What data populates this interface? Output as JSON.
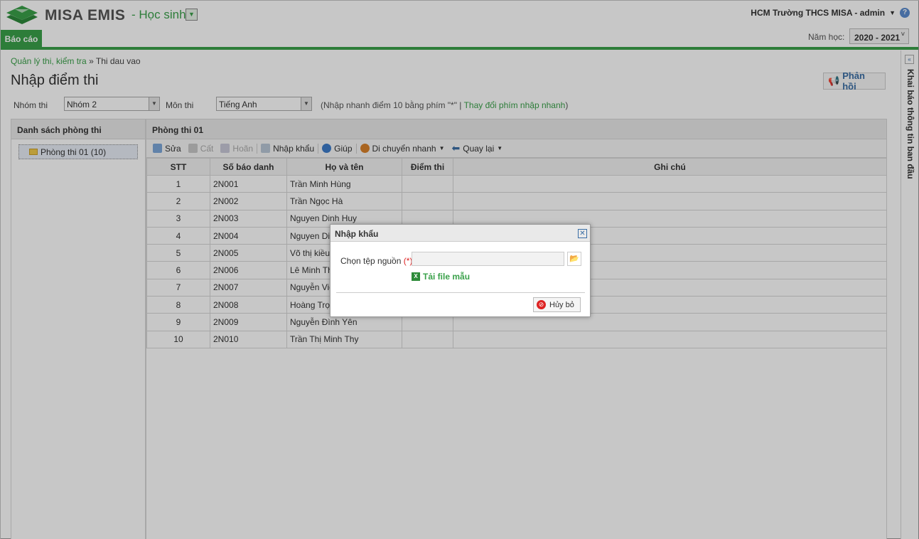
{
  "header": {
    "brand": "MISA EMIS",
    "module": "- Học sinh",
    "school_user": "HCM Trường THCS MISA - admin",
    "tab_report": "Báo cáo",
    "year_label": "Năm học:",
    "year_value": "2020 - 2021"
  },
  "breadcrumb": {
    "parent": "Quản lý thi, kiểm tra",
    "sep": "»",
    "current": "Thi dau vao"
  },
  "page_title": "Nhập điểm thi",
  "feedback_label": "Phản hồi",
  "filters": {
    "group_label": "Nhóm thi",
    "group_value": "Nhóm 2",
    "subject_label": "Môn thi",
    "subject_value": "Tiếng Anh",
    "hint_prefix": "(Nhập nhanh điểm 10 bằng phím \"*\" |",
    "hint_link": "Thay đổi phím nhập nhanh",
    "hint_suffix": ")"
  },
  "left_panel": {
    "title": "Danh sách phòng thi",
    "room": "Phòng thi 01 (10)"
  },
  "main_panel": {
    "title": "Phòng thi 01",
    "toolbar": {
      "edit": "Sửa",
      "save": "Cất",
      "undo": "Hoãn",
      "import": "Nhập khẩu",
      "help": "Giúp",
      "move": "Di chuyển nhanh",
      "back": "Quay lại"
    },
    "columns": {
      "stt": "STT",
      "sbd": "Số báo danh",
      "name": "Họ và tên",
      "score": "Điểm thi",
      "note": "Ghi chú"
    },
    "rows": [
      {
        "stt": "1",
        "sbd": "2N001",
        "name": "Trần Minh Hùng"
      },
      {
        "stt": "2",
        "sbd": "2N002",
        "name": "Trần Ngọc Hà"
      },
      {
        "stt": "3",
        "sbd": "2N003",
        "name": "Nguyen Dinh Huy"
      },
      {
        "stt": "4",
        "sbd": "2N004",
        "name": "Nguyen Dinh"
      },
      {
        "stt": "5",
        "sbd": "2N005",
        "name": "Võ thị kiều"
      },
      {
        "stt": "6",
        "sbd": "2N006",
        "name": "Lê Minh Tha"
      },
      {
        "stt": "7",
        "sbd": "2N007",
        "name": "Nguyễn Viế"
      },
      {
        "stt": "8",
        "sbd": "2N008",
        "name": "Hoàng Trọn"
      },
      {
        "stt": "9",
        "sbd": "2N009",
        "name": "Nguyễn Đình Yên"
      },
      {
        "stt": "10",
        "sbd": "2N010",
        "name": "Trần Thị Minh Thy"
      }
    ]
  },
  "right_bar": {
    "label": "Khai báo thông tin ban đầu"
  },
  "dialog": {
    "title": "Nhập khẩu",
    "source_label": "Chọn tệp nguồn",
    "required_mark": "(*)",
    "template_link": "Tải file mẫu",
    "cancel": "Hủy bỏ"
  },
  "colors": {
    "accent": "#3aa14a",
    "link_blue": "#3a6ea5"
  }
}
